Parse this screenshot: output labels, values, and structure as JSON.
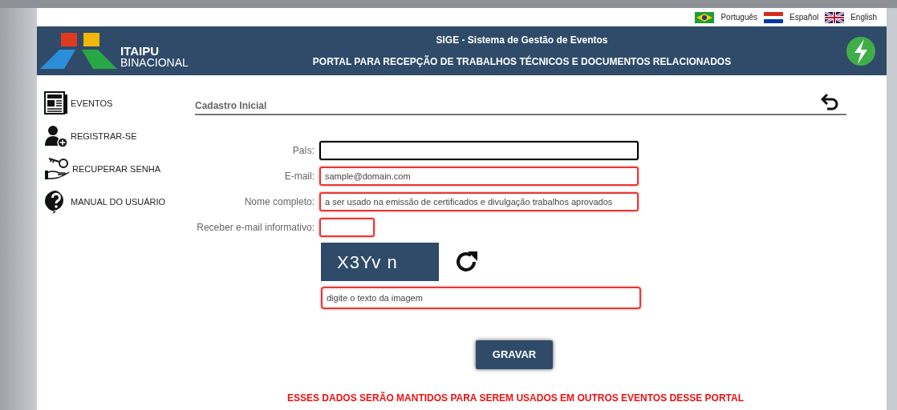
{
  "languages": [
    {
      "label": "Português"
    },
    {
      "label": "Español"
    },
    {
      "label": "English"
    }
  ],
  "header": {
    "logo_line1": "ITAIPU",
    "logo_line2": "BINACIONAL",
    "title": "SIGE - Sistema de Gestão de Eventos",
    "subtitle": "PORTAL PARA RECEPÇÃO DE TRABALHOS TÉCNICOS E DOCUMENTOS RELACIONADOS"
  },
  "sidebar": {
    "items": [
      {
        "label": "EVENTOS"
      },
      {
        "label": "REGISTRAR-SE"
      },
      {
        "label": "RECUPERAR SENHA"
      },
      {
        "label": "MANUAL DO USUÁRIO"
      }
    ]
  },
  "form": {
    "title": "Cadastro Inicial",
    "fields": [
      {
        "kind": "text",
        "label": "País:",
        "focused": true,
        "invalid": false
      },
      {
        "kind": "text",
        "label": "E-mail:",
        "placeholder": "sample@domain.com",
        "focused": false,
        "invalid": true
      },
      {
        "kind": "text",
        "label": "Nome completo:",
        "placeholder": "a ser usado na emissão de certificados e divulgação trabalhos aprovados",
        "focused": false,
        "invalid": true
      },
      {
        "kind": "short",
        "label": "Receber e-mail informativo:",
        "focused": false,
        "invalid": true
      }
    ],
    "captcha": {
      "text": "X3Yv n",
      "placeholder": "digite o texto da imagem",
      "invalid": true
    },
    "submit": "GRAVAR",
    "notice": "ESSES DADOS SERÃO MANTIDOS PARA SEREM USADOS EM OUTROS EVENTOS DESSE PORTAL"
  }
}
